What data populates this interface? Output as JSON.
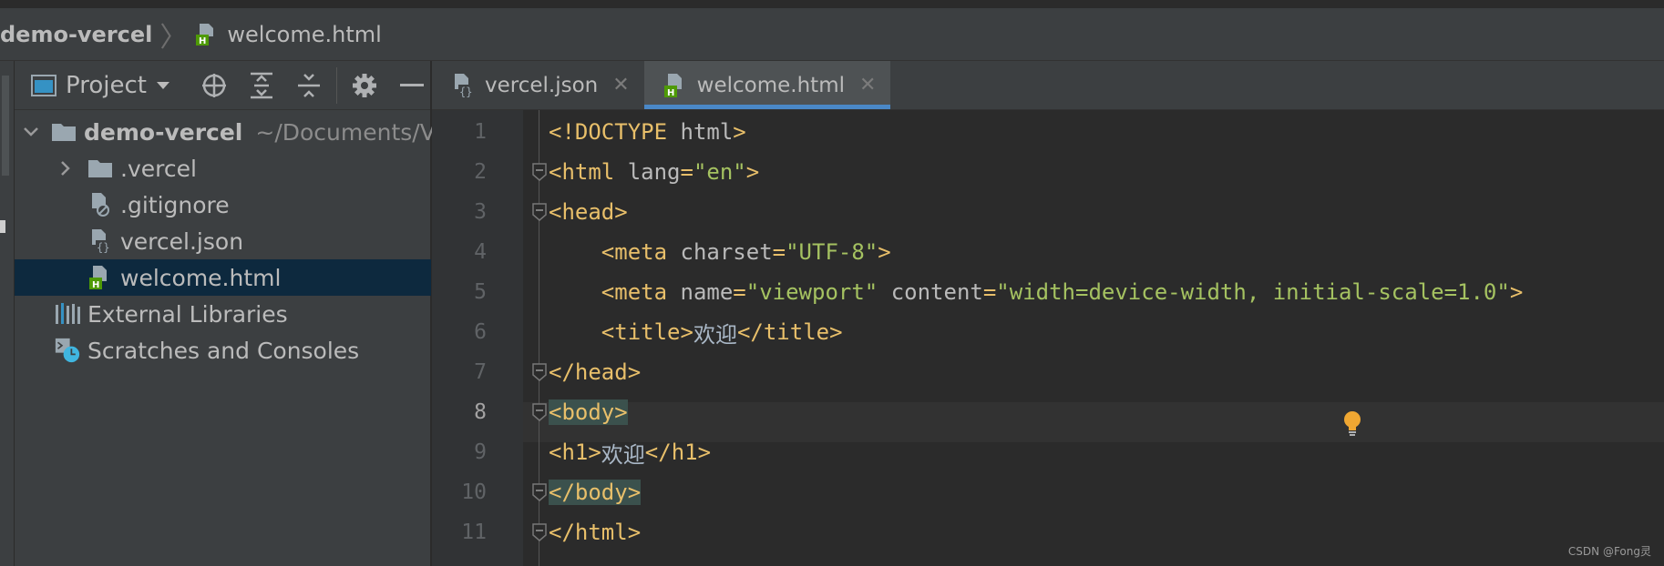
{
  "breadcrumb": {
    "root": "demo-vercel",
    "file": "welcome.html"
  },
  "project_panel": {
    "title": "Project",
    "tree": [
      {
        "label": "demo-vercel",
        "path": "~/Documents/V",
        "type": "folder-open"
      },
      {
        "label": ".vercel",
        "type": "folder"
      },
      {
        "label": ".gitignore",
        "type": "gitignore"
      },
      {
        "label": "vercel.json",
        "type": "json"
      },
      {
        "label": "welcome.html",
        "type": "html",
        "selected": true
      },
      {
        "label": "External Libraries",
        "type": "libraries"
      },
      {
        "label": "Scratches and Consoles",
        "type": "scratches"
      }
    ]
  },
  "tabs": [
    {
      "label": "vercel.json",
      "active": false
    },
    {
      "label": "welcome.html",
      "active": true
    }
  ],
  "editor": {
    "current_line": 8,
    "lines": [
      {
        "n": "1",
        "parts": [
          [
            "tag",
            "<!DOCTYPE "
          ],
          [
            "attr",
            "html"
          ],
          [
            "tag",
            ">"
          ]
        ]
      },
      {
        "n": "2",
        "parts": [
          [
            "tag",
            "<html "
          ],
          [
            "attr",
            "lang"
          ],
          [
            "tag",
            "="
          ],
          [
            "val",
            "\"en\""
          ],
          [
            "tag",
            ">"
          ]
        ]
      },
      {
        "n": "3",
        "parts": [
          [
            "tag",
            "<head>"
          ]
        ]
      },
      {
        "n": "4",
        "parts": [
          [
            "txt",
            "    "
          ],
          [
            "tag",
            "<meta "
          ],
          [
            "attr",
            "charset"
          ],
          [
            "tag",
            "="
          ],
          [
            "val",
            "\"UTF-8\""
          ],
          [
            "tag",
            ">"
          ]
        ]
      },
      {
        "n": "5",
        "parts": [
          [
            "txt",
            "    "
          ],
          [
            "tag",
            "<meta "
          ],
          [
            "attr",
            "name"
          ],
          [
            "tag",
            "="
          ],
          [
            "val",
            "\"viewport\""
          ],
          [
            "attr",
            " content"
          ],
          [
            "tag",
            "="
          ],
          [
            "val",
            "\"width=device-width, initial-scale=1.0\""
          ],
          [
            "tag",
            ">"
          ]
        ]
      },
      {
        "n": "6",
        "parts": [
          [
            "txt",
            "    "
          ],
          [
            "tag",
            "<title>"
          ],
          [
            "txt",
            "欢迎"
          ],
          [
            "tag",
            "</title>"
          ]
        ]
      },
      {
        "n": "7",
        "parts": [
          [
            "tag",
            "</head>"
          ]
        ]
      },
      {
        "n": "8",
        "parts": [
          [
            "tag hl",
            "<body>"
          ]
        ]
      },
      {
        "n": "9",
        "parts": [
          [
            "tag",
            "<h1>"
          ],
          [
            "txt",
            "欢迎"
          ],
          [
            "tag",
            "</h1>"
          ]
        ]
      },
      {
        "n": "10",
        "parts": [
          [
            "tag hl",
            "</body>"
          ]
        ]
      },
      {
        "n": "11",
        "parts": [
          [
            "tag",
            "</html>"
          ]
        ]
      }
    ]
  },
  "watermark": "CSDN @Fong灵",
  "colors": {
    "accent": "#4a88c7",
    "tag": "#e8bf6a",
    "string": "#a5c261",
    "bulb": "#f0a732",
    "html_icon": "#4e9a06"
  }
}
